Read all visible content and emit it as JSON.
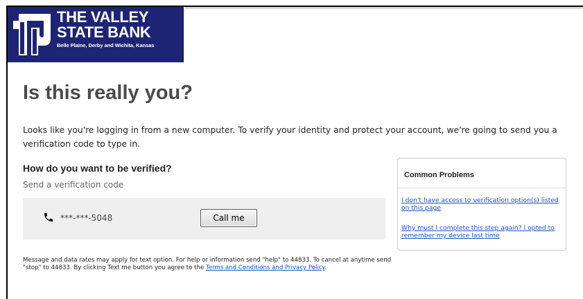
{
  "bank": {
    "name_line1": "THE VALLEY",
    "name_line2": "STATE BANK",
    "locations": "Belle Plaine, Derby and Wichita, Kansas"
  },
  "page": {
    "title": "Is this really you?",
    "intro": "Looks like you're logging in from a new computer. To verify your identity and protect your account, we're going to send you a verification code to type in."
  },
  "verification": {
    "heading": "How do you want to be verified?",
    "subheading": "Send a verification code",
    "phone_icon": "phone-icon",
    "masked_number": "***-***-5048",
    "call_button": "Call me"
  },
  "disclaimer": {
    "text": "Message and data rates may apply for text option. For help or information send \"help\" to 44833. To cancel at anytime send \"stop\" to 44833. By clicking Text me button you agree to the ",
    "link": "Terms and Conditions and Privacy Policy",
    "end": "."
  },
  "common_problems": {
    "heading": "Common Problems",
    "links": [
      "I don't have access to verification option(s) listed on this page",
      "Why must I complete this step again? I opted to remember my device last time"
    ]
  },
  "colors": {
    "logo_background": "#1c2473",
    "link": "#1a52c4",
    "option_background": "#efefef"
  }
}
